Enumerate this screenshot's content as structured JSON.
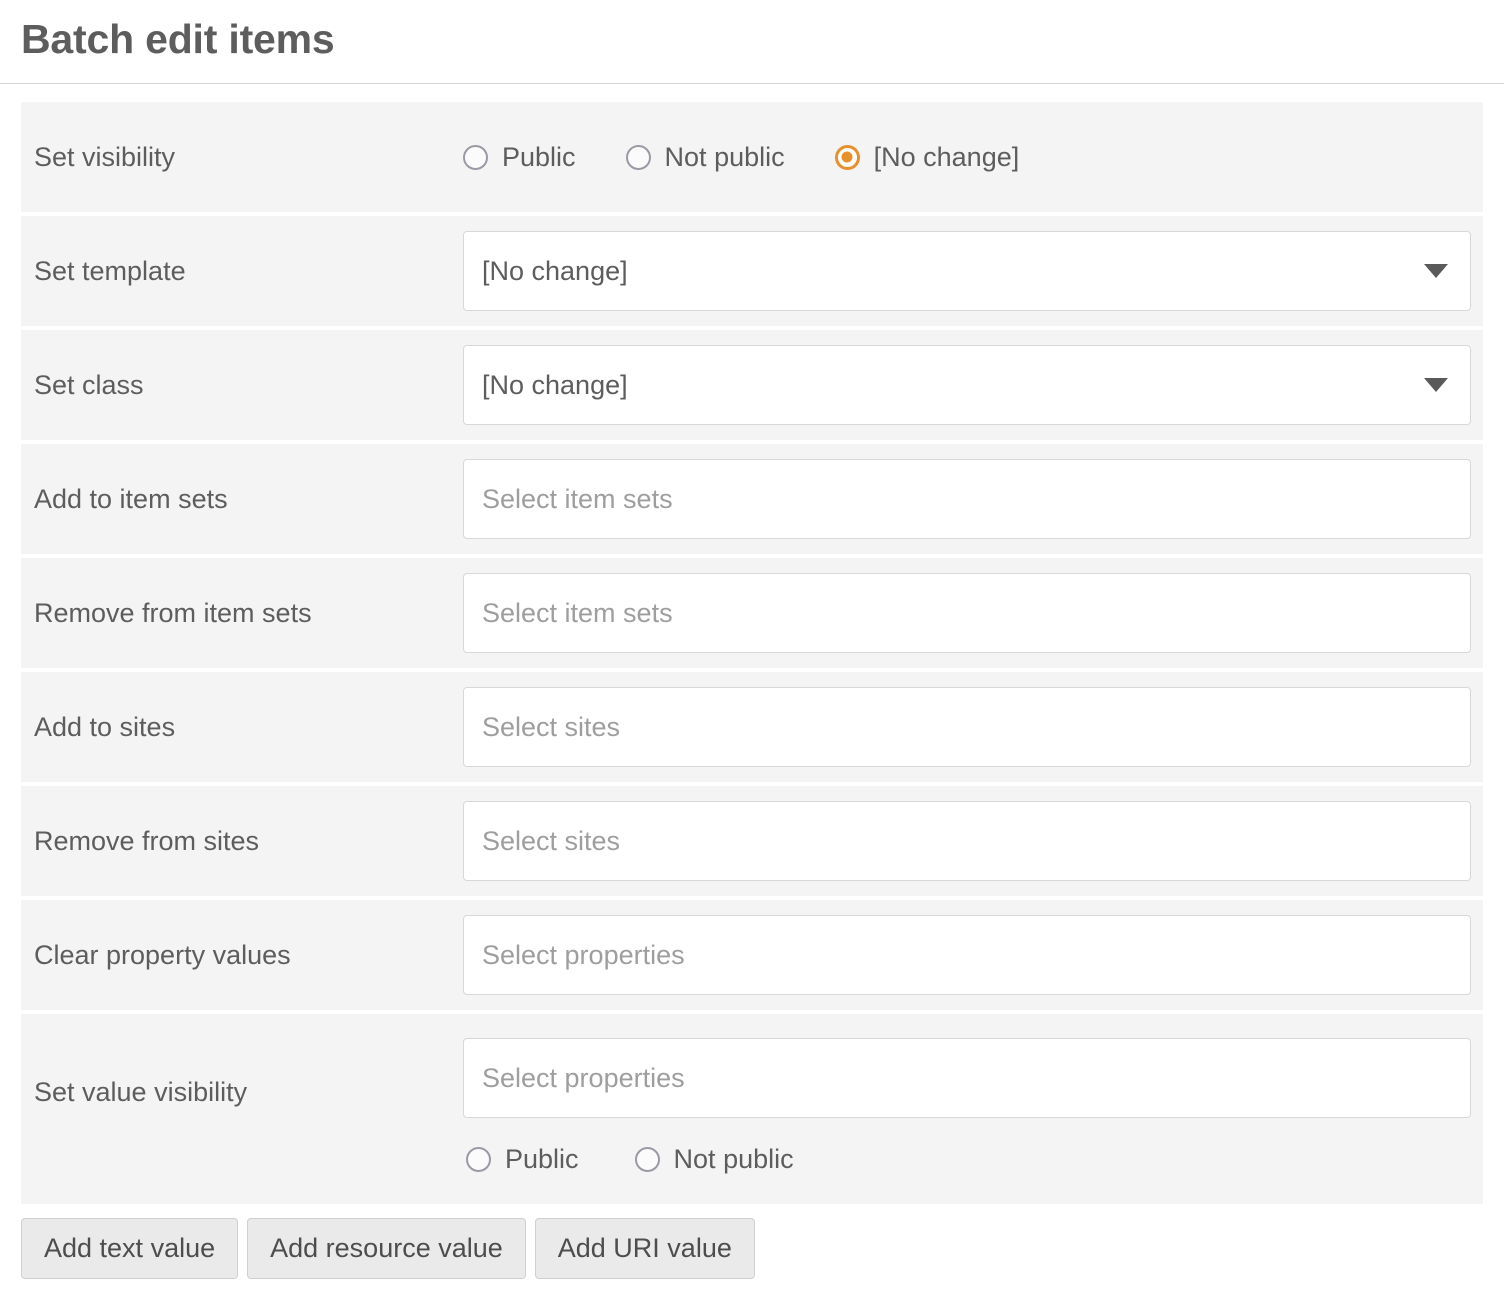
{
  "page": {
    "title": "Batch edit items"
  },
  "rows": [
    {
      "label": "Set visibility",
      "type": "radios",
      "options": [
        {
          "label": "Public",
          "checked": false
        },
        {
          "label": "Not public",
          "checked": false
        },
        {
          "label": "[No change]",
          "checked": true
        }
      ]
    },
    {
      "label": "Set template",
      "type": "select",
      "value": "[No change]"
    },
    {
      "label": "Set class",
      "type": "select",
      "value": "[No change]"
    },
    {
      "label": "Add to item sets",
      "type": "text",
      "placeholder": "Select item sets"
    },
    {
      "label": "Remove from item sets",
      "type": "text",
      "placeholder": "Select item sets"
    },
    {
      "label": "Add to sites",
      "type": "text",
      "placeholder": "Select sites"
    },
    {
      "label": "Remove from sites",
      "type": "text",
      "placeholder": "Select sites"
    },
    {
      "label": "Clear property values",
      "type": "text",
      "placeholder": "Select properties"
    },
    {
      "label": "Set value visibility",
      "type": "text-radios",
      "placeholder": "Select properties",
      "options": [
        {
          "label": "Public",
          "checked": false
        },
        {
          "label": "Not public",
          "checked": false
        }
      ]
    }
  ],
  "buttons": [
    {
      "label": "Add text value"
    },
    {
      "label": "Add resource value"
    },
    {
      "label": "Add URI value"
    }
  ],
  "colors": {
    "accent": "#e8902e",
    "row_background": "#f4f4f4",
    "text": "#5d5d5d",
    "placeholder": "#9e9e9e",
    "border": "#d8d8d8",
    "button_background": "#eaeaea"
  },
  "icons": {
    "caret": "chevron-down-icon"
  }
}
